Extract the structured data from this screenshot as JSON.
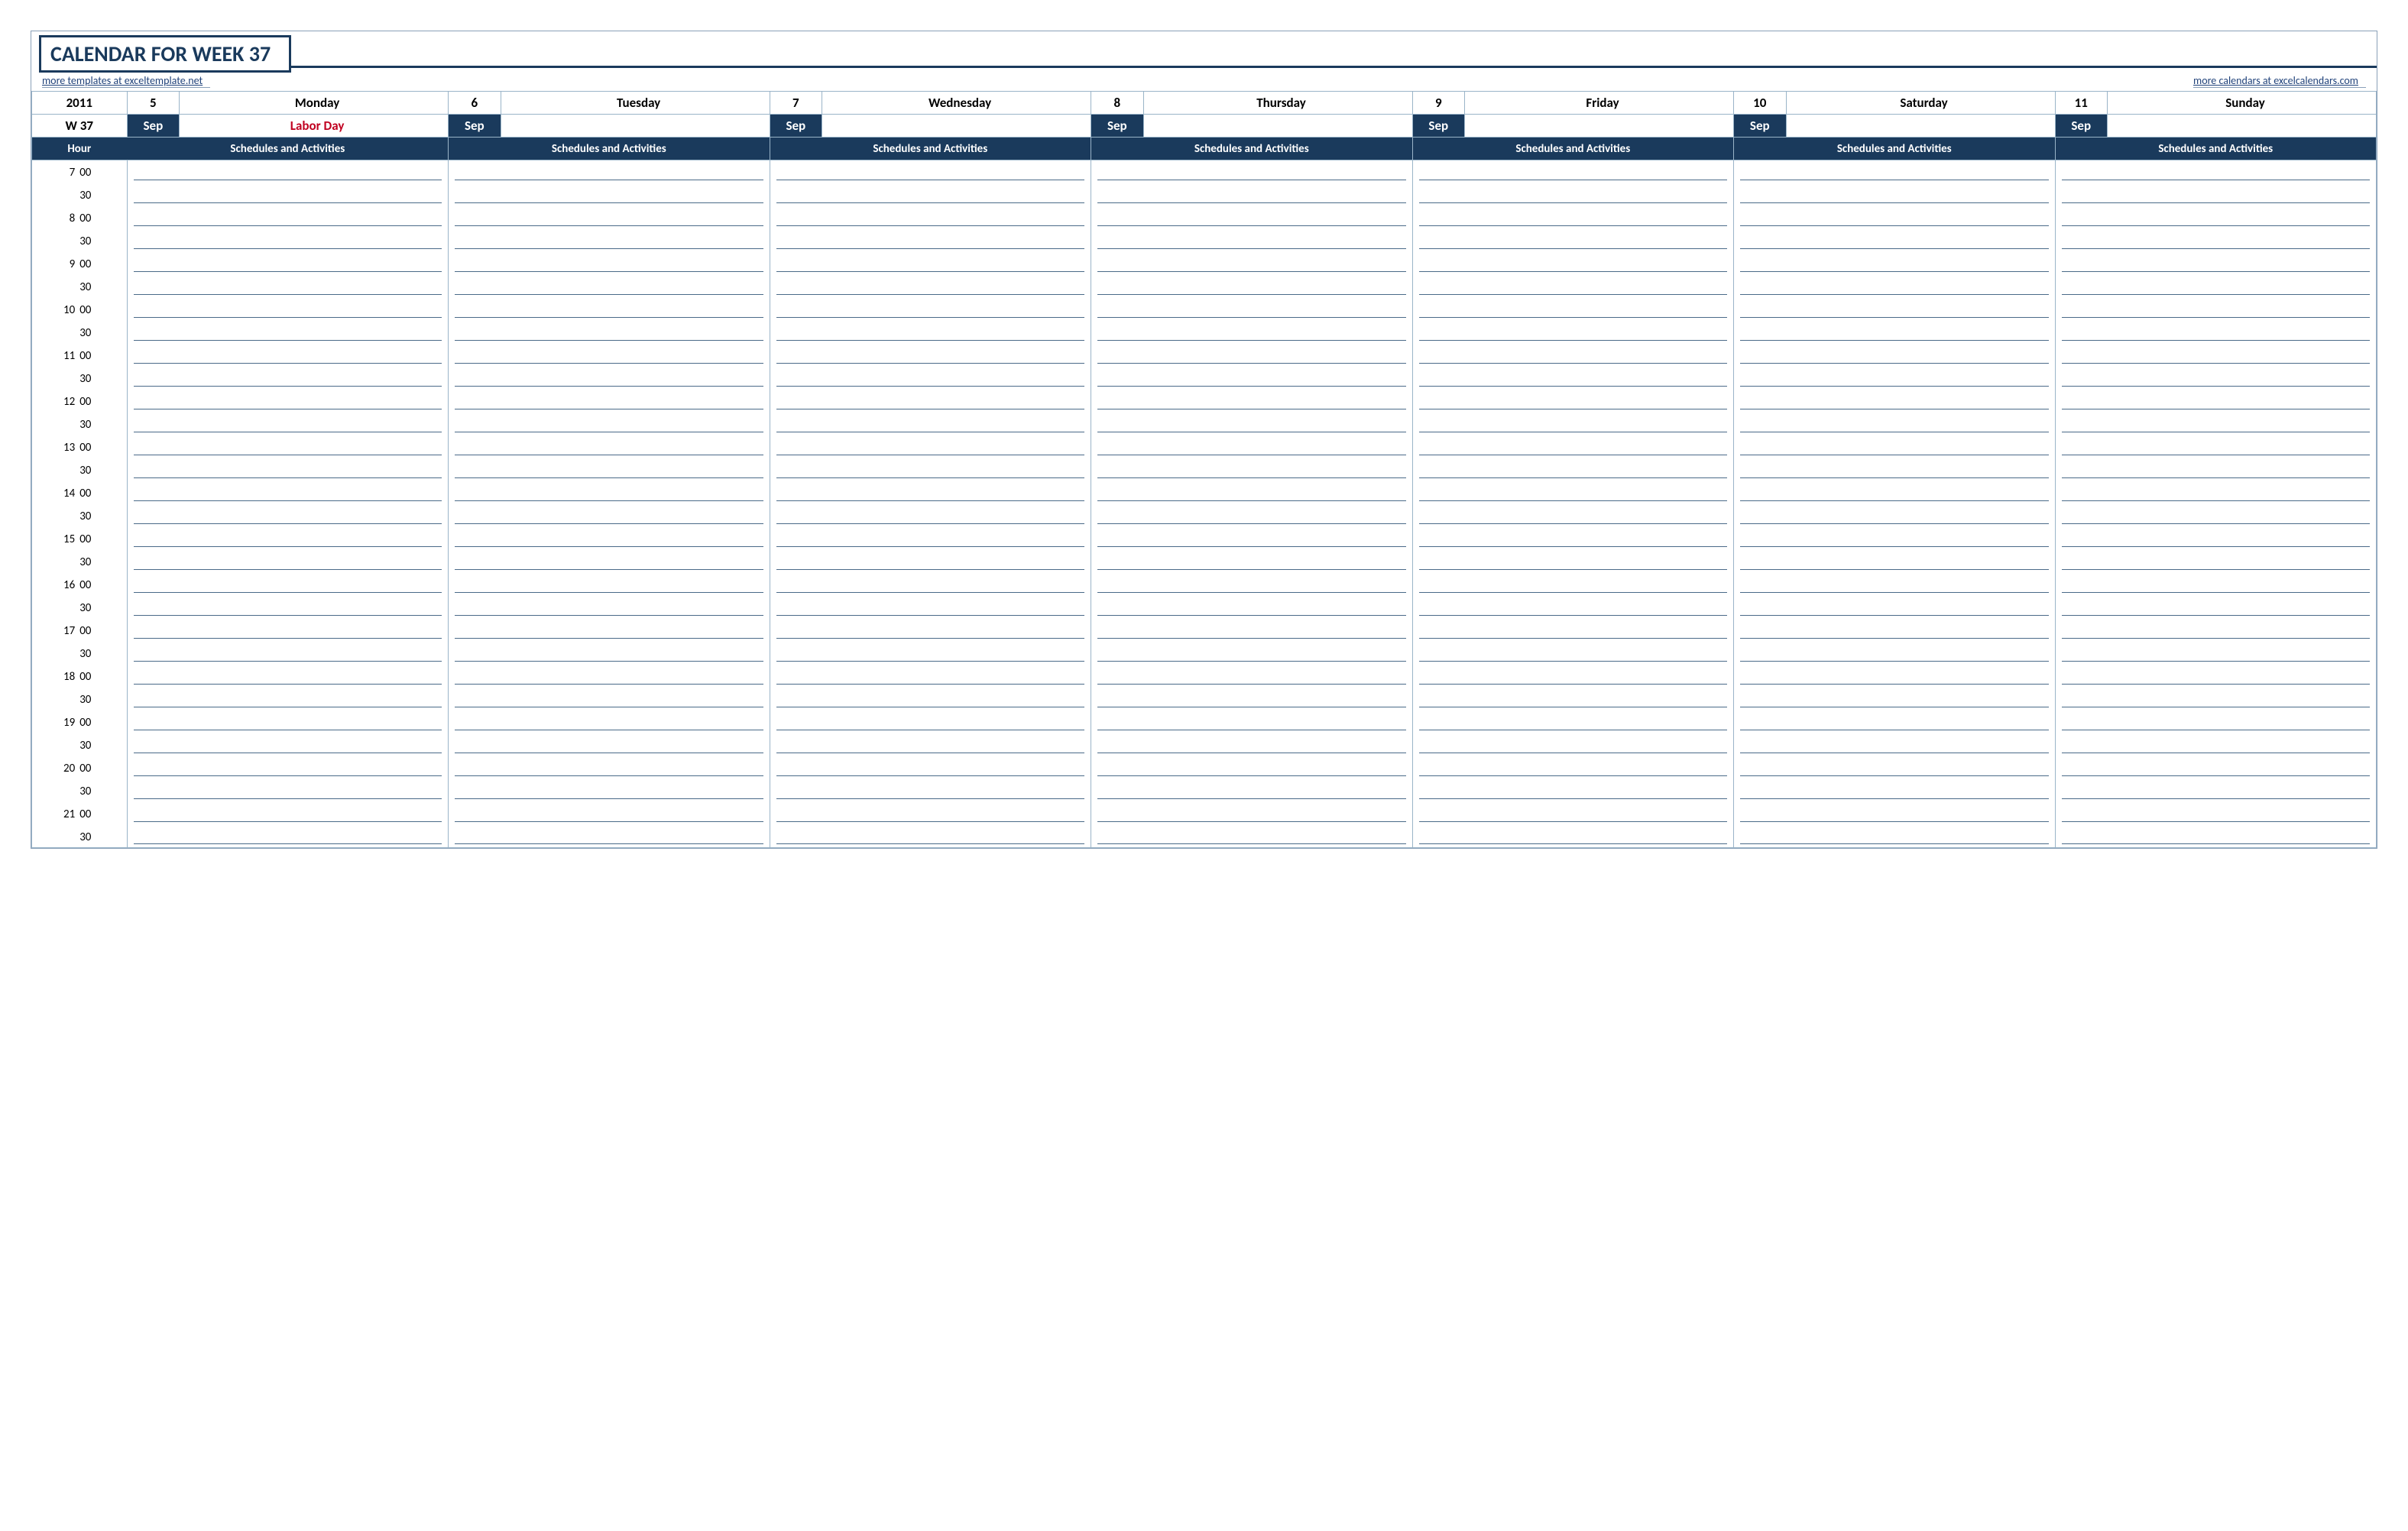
{
  "title": "CALENDAR FOR WEEK 37",
  "links": {
    "left": "more templates at exceltemplate.net",
    "right": "more calendars at excelcalendars.com"
  },
  "header": {
    "year": "2011",
    "week_label": "W 37",
    "hour_label": "Hour",
    "sched_label": "Schedules and Activities"
  },
  "days": [
    {
      "num": "5",
      "name": "Monday",
      "month": "Sep",
      "holiday": "Labor Day"
    },
    {
      "num": "6",
      "name": "Tuesday",
      "month": "Sep",
      "holiday": ""
    },
    {
      "num": "7",
      "name": "Wednesday",
      "month": "Sep",
      "holiday": ""
    },
    {
      "num": "8",
      "name": "Thursday",
      "month": "Sep",
      "holiday": ""
    },
    {
      "num": "9",
      "name": "Friday",
      "month": "Sep",
      "holiday": ""
    },
    {
      "num": "10",
      "name": "Saturday",
      "month": "Sep",
      "holiday": ""
    },
    {
      "num": "11",
      "name": "Sunday",
      "month": "Sep",
      "holiday": ""
    }
  ],
  "hours": [
    {
      "h": "7",
      "m": "00"
    },
    {
      "h": "",
      "m": "30"
    },
    {
      "h": "8",
      "m": "00"
    },
    {
      "h": "",
      "m": "30"
    },
    {
      "h": "9",
      "m": "00"
    },
    {
      "h": "",
      "m": "30"
    },
    {
      "h": "10",
      "m": "00"
    },
    {
      "h": "",
      "m": "30"
    },
    {
      "h": "11",
      "m": "00"
    },
    {
      "h": "",
      "m": "30"
    },
    {
      "h": "12",
      "m": "00"
    },
    {
      "h": "",
      "m": "30"
    },
    {
      "h": "13",
      "m": "00"
    },
    {
      "h": "",
      "m": "30"
    },
    {
      "h": "14",
      "m": "00"
    },
    {
      "h": "",
      "m": "30"
    },
    {
      "h": "15",
      "m": "00"
    },
    {
      "h": "",
      "m": "30"
    },
    {
      "h": "16",
      "m": "00"
    },
    {
      "h": "",
      "m": "30"
    },
    {
      "h": "17",
      "m": "00"
    },
    {
      "h": "",
      "m": "30"
    },
    {
      "h": "18",
      "m": "00"
    },
    {
      "h": "",
      "m": "30"
    },
    {
      "h": "19",
      "m": "00"
    },
    {
      "h": "",
      "m": "30"
    },
    {
      "h": "20",
      "m": "00"
    },
    {
      "h": "",
      "m": "30"
    },
    {
      "h": "21",
      "m": "00"
    },
    {
      "h": "",
      "m": "30"
    }
  ]
}
